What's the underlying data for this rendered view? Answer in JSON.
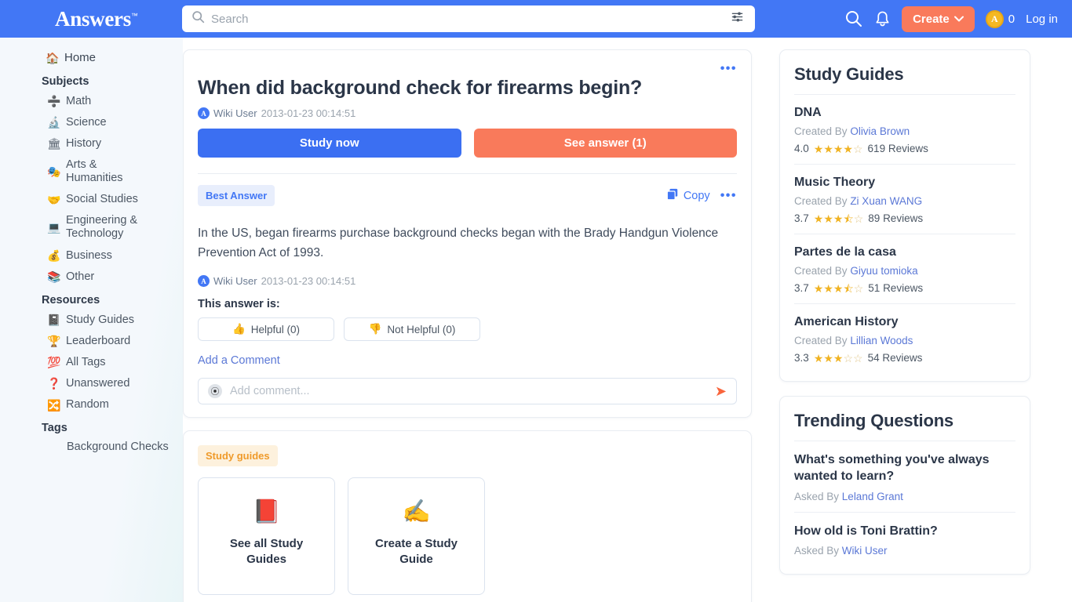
{
  "header": {
    "logo_text": "Answers",
    "logo_tm": "™",
    "search": {
      "placeholder": "Search",
      "value": ""
    },
    "search_icon": "search-icon",
    "filter_icon": "filter-sliders-icon",
    "magnifier_icon": "search-icon",
    "bell_icon": "notification-bell-icon",
    "create_label": "Create",
    "create_caret": "⌄",
    "coin_letter": "A",
    "coin_count": "0",
    "login_label": "Log in",
    "brand_blue": "#4277f5",
    "accent_orange": "#f97a5b"
  },
  "sidebar": {
    "home": {
      "label": "Home",
      "emoji": "🏠"
    },
    "subjects_header": "Subjects",
    "subjects": [
      {
        "label": "Math",
        "emoji": "➗"
      },
      {
        "label": "Science",
        "emoji": "🔬"
      },
      {
        "label": "History",
        "emoji": "🏛"
      },
      {
        "label": "Arts & Humanities",
        "emoji": "🎭"
      },
      {
        "label": "Social Studies",
        "emoji": "🤝"
      },
      {
        "label": "Engineering & Technology",
        "emoji": "💻"
      },
      {
        "label": "Business",
        "emoji": "💰"
      },
      {
        "label": "Other",
        "emoji": "📚"
      }
    ],
    "resources_header": "Resources",
    "resources": [
      {
        "label": "Study Guides",
        "emoji": "📓"
      },
      {
        "label": "Leaderboard",
        "emoji": "🏆"
      },
      {
        "label": "All Tags",
        "emoji": "💯"
      },
      {
        "label": "Unanswered",
        "emoji": "❓"
      },
      {
        "label": "Random",
        "emoji": "🔀"
      }
    ],
    "tags_header": "Tags",
    "tags": [
      {
        "label": "Background Checks"
      }
    ]
  },
  "question": {
    "title": "When did background check for firearms begin?",
    "author": "Wiki User",
    "timestamp": "2013-01-23 00:14:51",
    "avatar_letter": "A",
    "study_now_label": "Study now",
    "see_answer_label": "See answer (1)",
    "more_dots": "•••"
  },
  "answer": {
    "badge": "Best Answer",
    "copy_label": "Copy",
    "more_dots": "•••",
    "text": "In the US, began firearms purchase background checks began with the Brady Handgun Violence Prevention Act of 1993.",
    "author": "Wiki User",
    "timestamp": "2013-01-23 00:14:51",
    "avatar_letter": "A",
    "rating_label": "This answer is:",
    "helpful_label": "Helpful (0)",
    "helpful_emoji": "👍",
    "not_helpful_label": "Not Helpful (0)",
    "not_helpful_emoji": "👎",
    "add_comment_link": "Add a Comment",
    "comment_placeholder": "Add comment...",
    "comment_value": "",
    "send_icon": "➤"
  },
  "study_guides_section": {
    "badge": "Study guides",
    "cards": [
      {
        "label": "See all Study Guides",
        "emoji": "📕"
      },
      {
        "label": "Create a Study Guide",
        "emoji": "✍️"
      }
    ]
  },
  "rail": {
    "study_guides_title": "Study Guides",
    "created_by_label": "Created By",
    "reviews_label": "Reviews",
    "guides": [
      {
        "name": "DNA",
        "author": "Olivia Brown",
        "rating": "4.0",
        "stars_full": 4,
        "stars_half": 0,
        "reviews": "619"
      },
      {
        "name": "Music Theory",
        "author": "Zi Xuan WANG",
        "rating": "3.7",
        "stars_full": 3,
        "stars_half": 1,
        "reviews": "89"
      },
      {
        "name": "Partes de la casa",
        "author": "Giyuu tomioka",
        "rating": "3.7",
        "stars_full": 3,
        "stars_half": 1,
        "reviews": "51"
      },
      {
        "name": "American History",
        "author": "Lillian Woods",
        "rating": "3.3",
        "stars_full": 3,
        "stars_half": 0,
        "reviews": "54"
      }
    ],
    "trending_title": "Trending Questions",
    "asked_by_label": "Asked By",
    "trending": [
      {
        "question": "What's something you've always wanted to learn?",
        "author": "Leland Grant"
      },
      {
        "question": "How old is Toni Brattin?",
        "author": "Wiki User"
      }
    ]
  }
}
